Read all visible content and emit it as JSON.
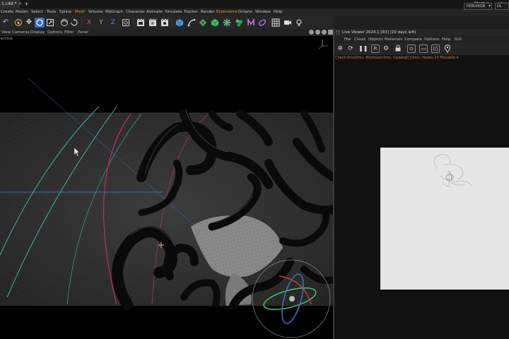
{
  "tabs": {
    "document": "1.c4d *",
    "close_glyph": "×",
    "add_glyph": "+",
    "layout_active": "Startup",
    "layout_next": "Standar"
  },
  "menu": {
    "items": [
      "Create",
      "Modes",
      "Select",
      "Tools",
      "Spline",
      "Mesh",
      "Volume",
      "MoGraph",
      "Character",
      "Animate",
      "Simulate",
      "Tracker",
      "Render",
      "Extensions",
      "Octane",
      "Window",
      "Help"
    ],
    "highlighted": [
      "Mesh",
      "Extensions"
    ]
  },
  "toolbar": {
    "axis_x": "X",
    "axis_y": "Y",
    "axis_z": "Z",
    "icons": [
      "undo-icon",
      "live-selection-icon",
      "move-icon",
      "rotate-icon",
      "scale-icon",
      "coordinate-system-icon",
      "x-axis-icon",
      "y-axis-icon",
      "z-axis-icon",
      "world-coordinates-icon",
      "render-view-icon",
      "render-settings-icon",
      "render-queue-icon",
      "cube-icon",
      "pen-icon",
      "subdivision-icon",
      "extrude-icon",
      "cloner-icon",
      "mograph-icon",
      "deformer-icon",
      "spline-icon",
      "grid-icon",
      "camera-icon",
      "light-icon"
    ]
  },
  "viewport": {
    "menu": [
      "View",
      "Cameras",
      "Display",
      "Options",
      "Filter",
      "Panel"
    ],
    "camera_label": "ective",
    "nav_icons": [
      "move-view-icon",
      "zoom-view-icon",
      "rotate-view-icon",
      "maximize-view-icon"
    ]
  },
  "live_viewer": {
    "title": "Live Viewer 2024.1 [R3] (20 days left)",
    "menu": [
      "File",
      "Cloud",
      "Objects",
      "Materials",
      "Compare",
      "Options",
      "Help",
      "GUI"
    ],
    "toolbar_icons": [
      "settings-icon",
      "refresh-icon",
      "pause-icon",
      "region-icon",
      "gear-icon",
      "lock-icon",
      "focus-icon",
      "snapshot-icon",
      "camera-icon",
      "pin-icon"
    ],
    "color_mode": "HDR/sRGB",
    "dl_mode": "DL",
    "status": "Check:0ms/0ms. MeshGen:0ms. Update[C]:0ms. Nodes:19 Movable:4"
  },
  "colors": {
    "menu_highlight": "#e49b3a",
    "status_text": "#d7773a",
    "spline_cyan": "#2fb8a7",
    "spline_pink": "#cc2f6a",
    "axis_blue": "#3b6fc4",
    "gizmo_green": "#3ec06a"
  }
}
